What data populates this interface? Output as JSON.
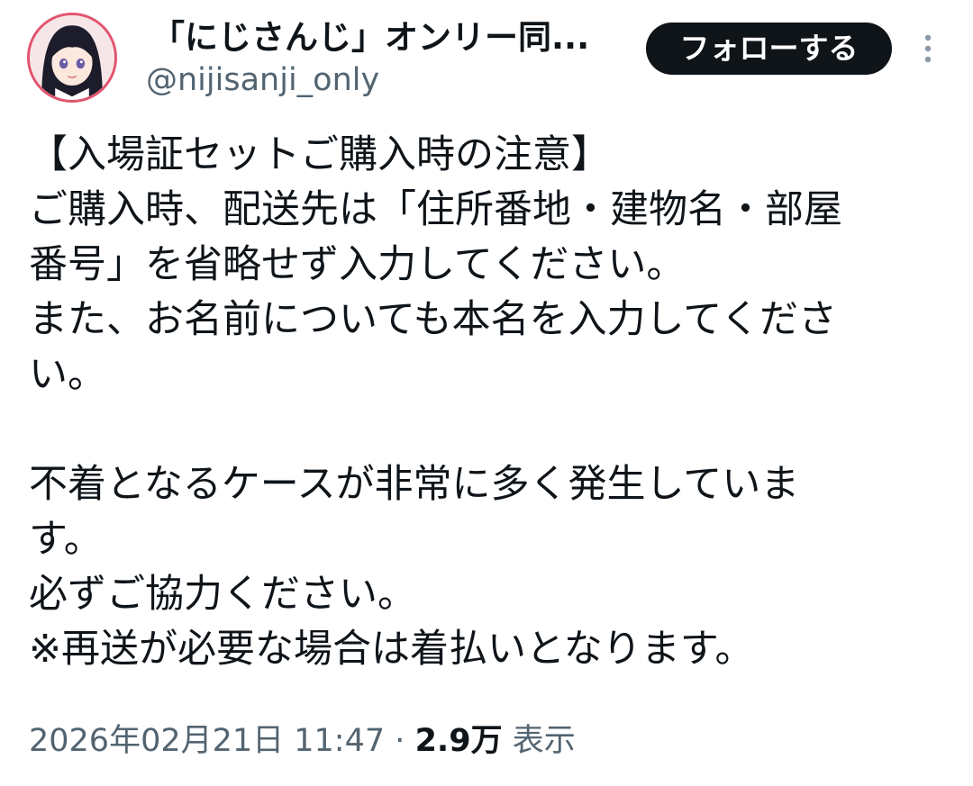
{
  "header": {
    "display_name": "「にじさんじ」オンリー同...",
    "handle": "@nijisanji_only",
    "follow_label": "フォローする",
    "more_icon": "more-vertical-icon"
  },
  "tweet": {
    "lines": [
      "【入場証セットご購入時の注意】",
      "ご購入時、配送先は「住所番地・建物名・部屋",
      "番号」を省略せず入力してください。",
      "また、お名前についても本名を入力してくださ",
      "い。",
      "",
      "不着となるケースが非常に多く発生していま",
      "す。",
      "必ずご協力ください。",
      "※再送が必要な場合は着払いとなります。"
    ]
  },
  "meta": {
    "timestamp": "2026年02月21日 11:47",
    "separator": "·",
    "views_count": "2.9万",
    "views_label": "表示"
  },
  "colors": {
    "avatar_ring": "#e2546e",
    "follow_bg": "#0f1419",
    "secondary_text": "#536471"
  }
}
